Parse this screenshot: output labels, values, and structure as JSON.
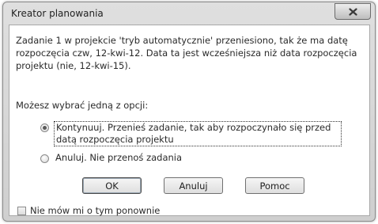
{
  "window": {
    "title": "Kreator planowania"
  },
  "message": "Zadanie 1 w projekcie 'tryb automatycznie' przeniesiono, tak że ma datę rozpoczęcia czw, 12-kwi-12. Data ta jest wcześniejsza niż data rozpoczęcia projektu (nie, 12-kwi-15).",
  "prompt": "Możesz wybrać jedną z opcji:",
  "options": [
    {
      "label": "Kontynuuj. Przenieś zadanie, tak aby rozpoczynało się przed datą rozpoczęcia projektu",
      "selected": true
    },
    {
      "label": "Anuluj. Nie przenoś zadania",
      "selected": false
    }
  ],
  "buttons": {
    "ok": "OK",
    "cancel": "Anuluj",
    "help": "Pomoc"
  },
  "checkbox": {
    "label": "Nie mów mi o tym ponownie",
    "checked": false
  },
  "colors": {
    "chrome": "#d8d8d8",
    "client_bg": "#ffffff",
    "text": "#2a2a2a"
  },
  "icons": {
    "close": "close-icon"
  }
}
